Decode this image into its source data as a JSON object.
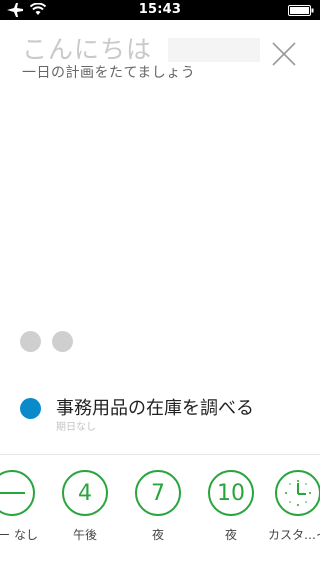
{
  "status_bar": {
    "time": "15:43"
  },
  "header": {
    "greeting": "こんにちは",
    "subtitle": "一日の計画をたてましょう"
  },
  "task": {
    "title": "事務用品の在庫を調べる",
    "due": "期日なし"
  },
  "options": [
    {
      "value": "",
      "label": "ー なし"
    },
    {
      "value": "4",
      "label": "午後"
    },
    {
      "value": "7",
      "label": "夜"
    },
    {
      "value": "10",
      "label": "夜"
    },
    {
      "value": "",
      "label": "カスタ…イ"
    }
  ],
  "colors": {
    "accent_green": "#2aa53e",
    "task_blue": "#0a8ac9",
    "dot_gray": "#cfcfcf"
  }
}
